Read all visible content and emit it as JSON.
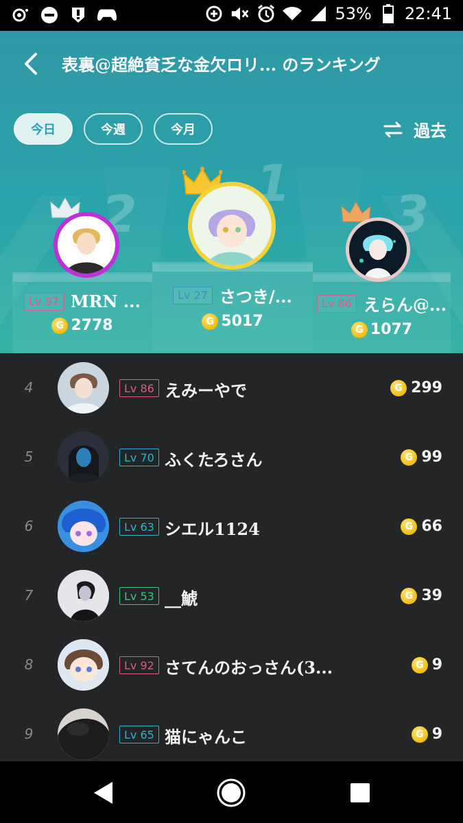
{
  "statusbar": {
    "battery": "53%",
    "time": "22:41"
  },
  "header": {
    "title": "表裏@超絶貧乏な金欠ロリ... のランキング",
    "back_label": "戻る"
  },
  "tabs": [
    {
      "label": "今日",
      "active": true
    },
    {
      "label": "今週",
      "active": false
    },
    {
      "label": "今月",
      "active": false
    }
  ],
  "past_button": {
    "label": "過去"
  },
  "podium": {
    "first": {
      "rank": "1",
      "level": "Lv 27",
      "name": "さつき/...",
      "coins": "5017",
      "level_color": "#3d8fc7"
    },
    "second": {
      "rank": "2",
      "level": "Lv 97",
      "name": "MRN ...",
      "coins": "2778",
      "level_color": "#e05a8a"
    },
    "third": {
      "rank": "3",
      "level": "Lv 86",
      "name": "えらん@...",
      "coins": "1077",
      "level_color": "#e05a8a"
    }
  },
  "list": [
    {
      "rank": "4",
      "level": "Lv 86",
      "name": "えみーやで",
      "coins": "299",
      "level_color": "#e05a8a",
      "avatar_color": "#c9d6df"
    },
    {
      "rank": "5",
      "level": "Lv 70",
      "name": "ふくたろさん",
      "coins": "99",
      "level_color": "#2fb3c6",
      "avatar_color": "#2b2f3a"
    },
    {
      "rank": "6",
      "level": "Lv 63",
      "name": "シエル1124",
      "coins": "66",
      "level_color": "#2fb3c6",
      "avatar_color": "#3a8fe0"
    },
    {
      "rank": "7",
      "level": "Lv 53",
      "name": "__鯱",
      "coins": "39",
      "level_color": "#3cc47a",
      "avatar_color": "#e6e6ea"
    },
    {
      "rank": "8",
      "level": "Lv 92",
      "name": "さてんのおっさん(3...",
      "coins": "9",
      "level_color": "#e05a8a",
      "avatar_color": "#dfe8f2"
    },
    {
      "rank": "9",
      "level": "Lv 65",
      "name": "猫にゃんこ",
      "coins": "9",
      "level_color": "#2fb3c6",
      "avatar_color": "#6e6a66"
    }
  ],
  "icons": {
    "coin": "G"
  }
}
